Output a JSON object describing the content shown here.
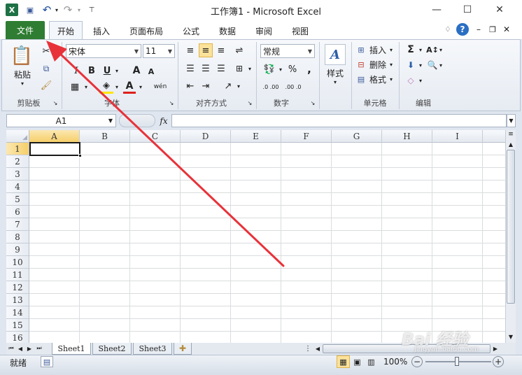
{
  "window": {
    "title": "工作簿1 - Microsoft Excel",
    "minimize": "—",
    "maximize": "☐",
    "close": "✕"
  },
  "qat": {
    "app_icon": "X",
    "save": "💾",
    "undo": "↶",
    "redo": "↷",
    "custom": "▾"
  },
  "tabs": {
    "file": "文件",
    "items": [
      "开始",
      "插入",
      "页面布局",
      "公式",
      "数据",
      "审阅",
      "视图"
    ],
    "active": "开始"
  },
  "ribbon": {
    "clipboard": {
      "paste": "粘贴",
      "label": "剪贴板"
    },
    "font": {
      "name": "宋体",
      "size": "11",
      "bold": "B",
      "italic": "I",
      "underline": "U",
      "grow": "A",
      "shrink": "A",
      "color": "A",
      "phonetic": "wén",
      "label": "字体"
    },
    "alignment": {
      "label": "对齐方式"
    },
    "number": {
      "format": "常规",
      "percent": "%",
      "comma": ",",
      "inc": ".0 .00",
      "dec": ".00 .0",
      "label": "数字"
    },
    "styles": {
      "label": "样式"
    },
    "cells": {
      "insert": "插入",
      "delete": "删除",
      "format": "格式",
      "label": "单元格"
    },
    "editing": {
      "sum": "Σ",
      "label": "编辑"
    }
  },
  "formula_bar": {
    "name_box": "A1",
    "fx": "fx",
    "value": ""
  },
  "grid": {
    "columns": [
      "A",
      "B",
      "C",
      "D",
      "E",
      "F",
      "G",
      "H",
      "I"
    ],
    "rows": [
      "1",
      "2",
      "3",
      "4",
      "5",
      "6",
      "7",
      "8",
      "9",
      "10",
      "11",
      "12",
      "13",
      "14",
      "15",
      "16"
    ],
    "selected": "A1"
  },
  "sheets": {
    "tabs": [
      "Sheet1",
      "Sheet2",
      "Sheet3"
    ],
    "active": "Sheet1"
  },
  "status": {
    "ready": "就绪",
    "zoom": "100%"
  },
  "annotation": {
    "arrow_color": "#e8323a"
  },
  "watermark": {
    "text": "Bai 经验",
    "sub": "jingyan.baidu.com"
  }
}
